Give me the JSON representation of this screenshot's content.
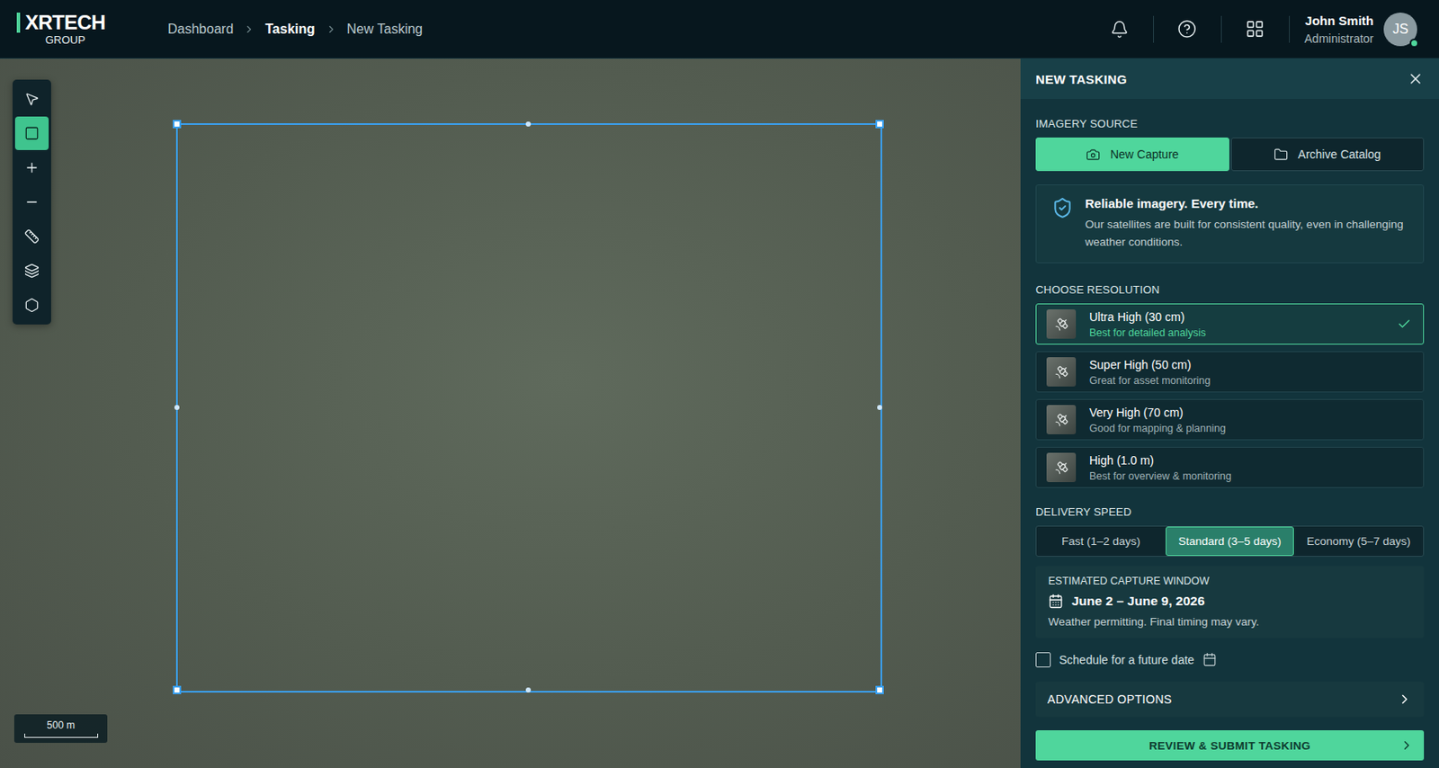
{
  "header": {
    "logo": {
      "title": "XRTECH",
      "subtitle": "GROUP"
    },
    "breadcrumbs": [
      {
        "label": "Dashboard",
        "selected": false
      },
      {
        "label": "Tasking",
        "selected": true
      },
      {
        "label": "New Tasking",
        "selected": false
      }
    ],
    "user": {
      "name": "John Smith",
      "role": "Administrator",
      "initials": "JS",
      "online": true
    }
  },
  "map": {
    "tools": [
      {
        "kind": "select",
        "selected": false
      },
      {
        "kind": "rectangle",
        "selected": true
      },
      {
        "kind": "zoom-in",
        "selected": false
      },
      {
        "kind": "zoom-out",
        "selected": false
      },
      {
        "kind": "measure",
        "selected": false
      },
      {
        "kind": "layers",
        "selected": false
      },
      {
        "kind": "export",
        "selected": false
      }
    ],
    "scale_bar": {
      "label": "500 m"
    }
  },
  "panel": {
    "title": "NEW TASKING",
    "imagery_source": {
      "label": "IMAGERY SOURCE",
      "options": [
        {
          "label": "New Capture",
          "kind": "capture",
          "selected": true
        },
        {
          "label": "Archive Catalog",
          "kind": "archive",
          "selected": false
        }
      ]
    },
    "notice": {
      "title": "Reliable imagery. Every time.",
      "text": "Our satellites are built for consistent quality, even in challenging weather conditions."
    },
    "resolution": {
      "label": "CHOOSE RESOLUTION",
      "options": [
        {
          "title": "Ultra High (30 cm)",
          "subtitle": "Best for detailed analysis",
          "selected": true
        },
        {
          "title": "Super High (50 cm)",
          "subtitle": "Great for asset monitoring",
          "selected": false
        },
        {
          "title": "Very High (70 cm)",
          "subtitle": "Good for mapping & planning",
          "selected": false
        },
        {
          "title": "High (1.0 m)",
          "subtitle": "Best for overview & monitoring",
          "selected": false
        }
      ]
    },
    "delivery": {
      "label": "DELIVERY SPEED",
      "options": [
        {
          "label": "Fast (1–2 days)",
          "selected": false
        },
        {
          "label": "Standard (3–5 days)",
          "selected": true
        },
        {
          "label": "Economy (5–7 days)",
          "selected": false
        }
      ]
    },
    "capture_window": {
      "label": "ESTIMATED CAPTURE WINDOW",
      "dates": "June 2 – June 9, 2026",
      "note": "Weather permitting. Final timing may vary."
    },
    "schedule": {
      "label": "Schedule for a future date",
      "checked": false
    },
    "advanced": {
      "label": "ADVANCED OPTIONS",
      "expanded": false
    },
    "submit": {
      "label": "REVIEW & SUBMIT TASKING"
    }
  }
}
